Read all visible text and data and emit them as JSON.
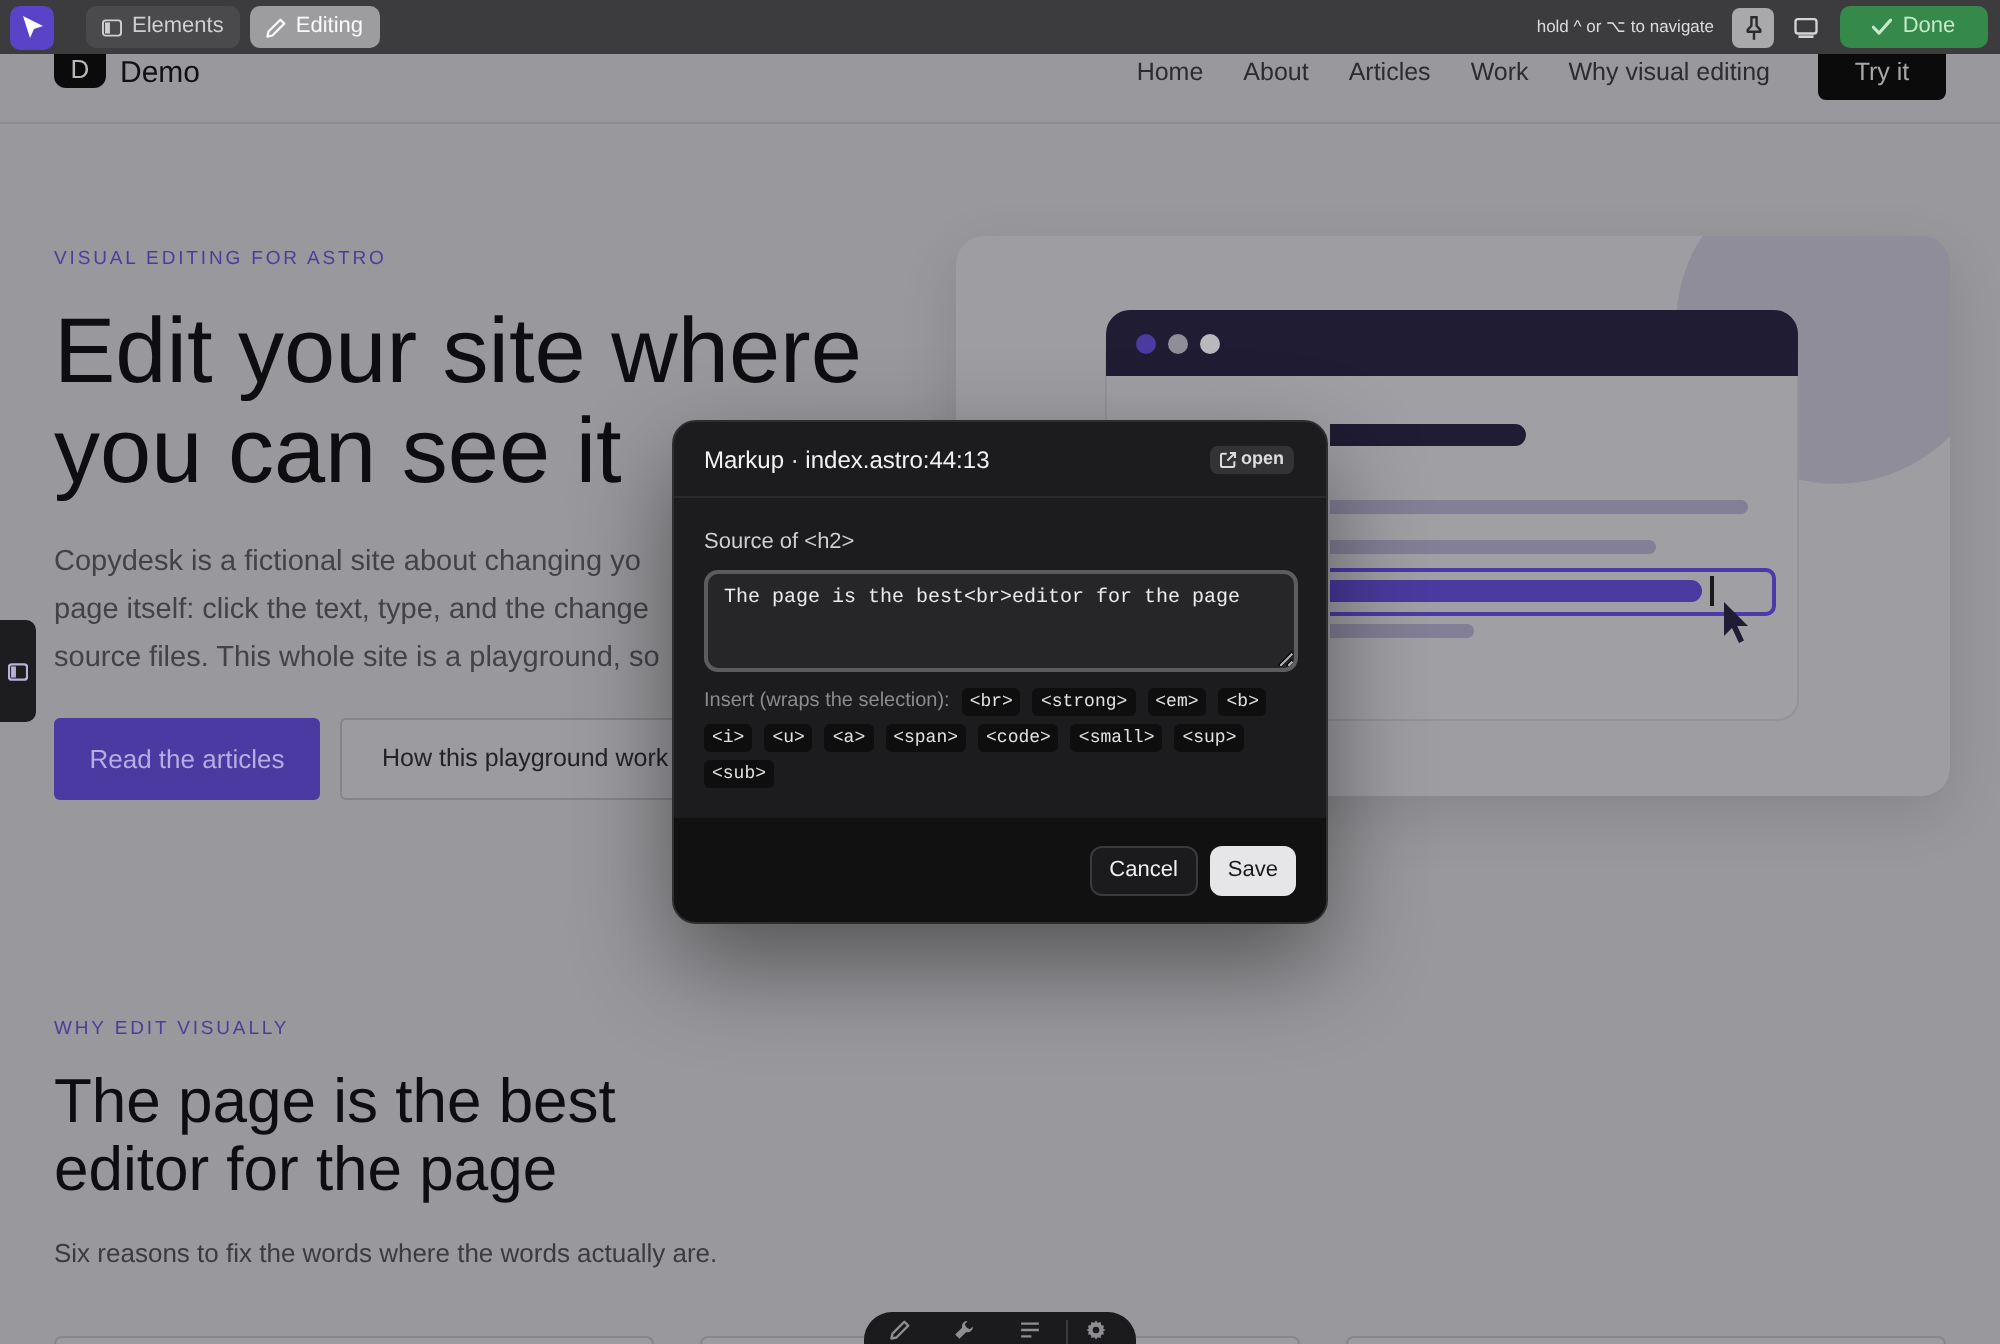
{
  "toolbar": {
    "mode_buttons": [
      {
        "label": "Elements",
        "selected": false
      },
      {
        "label": "Editing",
        "selected": true
      }
    ],
    "hint": "hold ^ or ⌥ to navigate",
    "pinned": true,
    "done_button": "Done"
  },
  "site_header": {
    "logo_letter": "D",
    "site_name": "Demo",
    "nav": [
      "Home",
      "About",
      "Articles",
      "Work",
      "Why visual editing"
    ],
    "cta": "Try it"
  },
  "hero": {
    "eyebrow": "VISUAL EDITING FOR ASTRO",
    "heading_lines": [
      "Edit your site where",
      "you can see it"
    ],
    "description_lines": [
      "Copydesk is a fictional site about changing yo",
      "page itself: click the text, type, and the change",
      "source files. This whole site is a playground, so"
    ],
    "buttons": [
      {
        "label": "Read the articles",
        "kind": "primary"
      },
      {
        "label": "How this playground work",
        "kind": "secondary"
      }
    ]
  },
  "markup_dialog": {
    "title": "Markup · index.astro:44:13",
    "open_link": "open",
    "source_label": "Source of <h2>",
    "source_value": "The page is the best<br>editor for the page",
    "insert_label": "Insert (wraps the selection):",
    "tags": [
      "<br>",
      "<strong>",
      "<em>",
      "<b>",
      "<i>",
      "<u>",
      "<a>",
      "<span>",
      "<code>",
      "<small>",
      "<sup>",
      "<sub>"
    ],
    "buttons": [
      {
        "label": "Cancel",
        "kind": "secondary"
      },
      {
        "label": "Save",
        "kind": "primary"
      }
    ]
  },
  "why_section": {
    "eyebrow": "WHY EDIT VISUALLY",
    "heading_lines": [
      "The page is the best",
      "editor for the page"
    ],
    "subtitle": "Six reasons to fix the words where the words actually are."
  }
}
